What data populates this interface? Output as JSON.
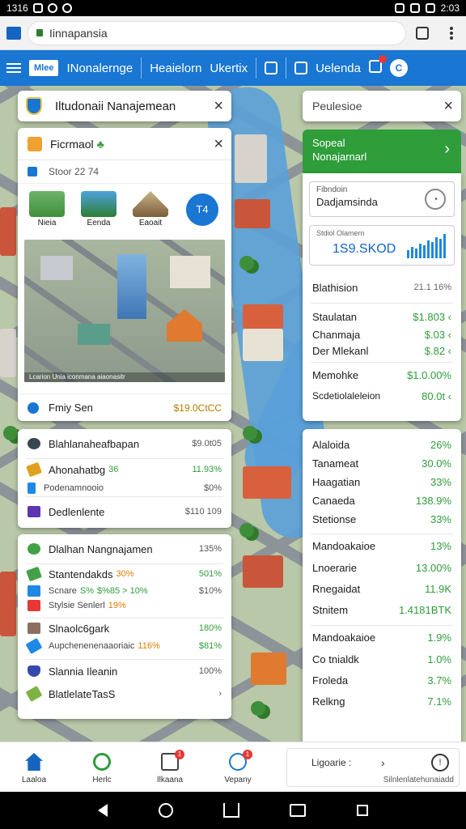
{
  "status_bar": {
    "time": "1316",
    "clock": "2:03"
  },
  "browser": {
    "url": "Iinnapansia"
  },
  "app_nav": {
    "logo": "Mlee",
    "items": [
      "INonalernge",
      "Heaielorn",
      "Ukertix",
      "Uelenda"
    ]
  },
  "title_card": {
    "title": "Iltudonaii Nanajemean"
  },
  "property_card": {
    "title": "Ficrmaol",
    "subtitle": "Stoor  22 74",
    "icons": [
      {
        "label": "Nieia",
        "icon": "park-icon"
      },
      {
        "label": "Eenda",
        "icon": "lake-icon"
      },
      {
        "label": "Eaoait",
        "icon": "temple-icon"
      }
    ],
    "action_label": "T4",
    "image_caption": "Lcarion Unia iconmana aiaonasitr",
    "footer_label": "Fmiy Sen",
    "footer_value": "$19.0CtCC"
  },
  "list_card_1": {
    "rows": [
      {
        "label": "Blahlanaheafbapan",
        "value": "$9.0t05"
      },
      {
        "label": "Ahonahatbg",
        "extra": "36",
        "value": "11.93%"
      },
      {
        "label": "Podenamnooio",
        "value": "$0%"
      },
      {
        "label": "Dedlenlente",
        "value": "$110 109"
      }
    ]
  },
  "list_card_2": {
    "header_label": "Dlalhan Nangnajamen",
    "header_value": "135%",
    "rows": [
      {
        "label": "Stantendakds",
        "extra": "30%",
        "value": "501%"
      },
      {
        "label": "Scnare",
        "extra": "S%",
        "extra2": "$%85 > 10%",
        "value": "$10%"
      },
      {
        "label": "Stylsie Senlerl",
        "extra": "19%",
        "value": ""
      },
      {
        "label": "Slnaolc6gark",
        "value": "180%"
      },
      {
        "label": "Aupchenenenaaoriaic",
        "extra": "116%",
        "value": "$81%"
      },
      {
        "label": "Slannia Ileanin",
        "value": "100%"
      },
      {
        "label": "BlatlelateTasS",
        "value": "›"
      }
    ]
  },
  "right_title": {
    "title": "Peulesioe"
  },
  "right_green": {
    "line1": "Sopeal",
    "line2": "Nonajarnarl"
  },
  "right_input": {
    "label": "Fibndoin",
    "value": "Dadjamsinda"
  },
  "right_stat": {
    "label": "Stdiol Olamern",
    "value": "1S9.SKOD"
  },
  "right_rows_1": [
    {
      "label": "Blathision",
      "value": "21.1 16%"
    },
    {
      "label": "Staulatan",
      "value": "$1.803 ‹"
    },
    {
      "label": "Chanmaja",
      "value": "$.03 ‹"
    },
    {
      "label": "Der Mlekanl",
      "value": "$.82 ‹"
    },
    {
      "label": "Memohke",
      "value": "$1.0.00%"
    },
    {
      "label": "Scdetiolaleleion",
      "value": "80.0t ‹"
    }
  ],
  "right_rows_2": [
    {
      "label": "Alaloida",
      "value": "26%"
    },
    {
      "label": "Tanameat",
      "value": "30.0%"
    },
    {
      "label": "Haagatian",
      "value": "33%"
    },
    {
      "label": "Canaeda",
      "value": "138.9%"
    },
    {
      "label": "Stetionse",
      "value": "33%"
    },
    {
      "label": "Mandoakaioe",
      "value": "13%"
    },
    {
      "label": "Lnoerarie",
      "value": "13.00%"
    },
    {
      "label": "Rnegaidat",
      "value": "11.9K"
    },
    {
      "label": "Stnitem",
      "value": "1.4181BTK"
    },
    {
      "label": "Mandoakaioe",
      "value": "1.9%"
    },
    {
      "label": "Co tnialdk",
      "value": "1.0%"
    },
    {
      "label": "Froleda",
      "value": "3.7%"
    },
    {
      "label": "Relkng",
      "value": "7.1%"
    }
  ],
  "bottom_nav": {
    "items": [
      {
        "label": "Laaloa",
        "icon": "home-icon"
      },
      {
        "label": "Herlc",
        "icon": "circle-icon"
      },
      {
        "label": "Ilkaana",
        "icon": "inbox-icon",
        "badge": "1"
      },
      {
        "label": "Vepany",
        "icon": "pen-icon",
        "badge": "1"
      }
    ],
    "right_label": "Ligoarie :",
    "right_sub": "Silnlenlatehunaiadd"
  },
  "colors": {
    "primary": "#1976d2",
    "accent_green": "#2e9d3a",
    "warning": "#e07a00"
  }
}
